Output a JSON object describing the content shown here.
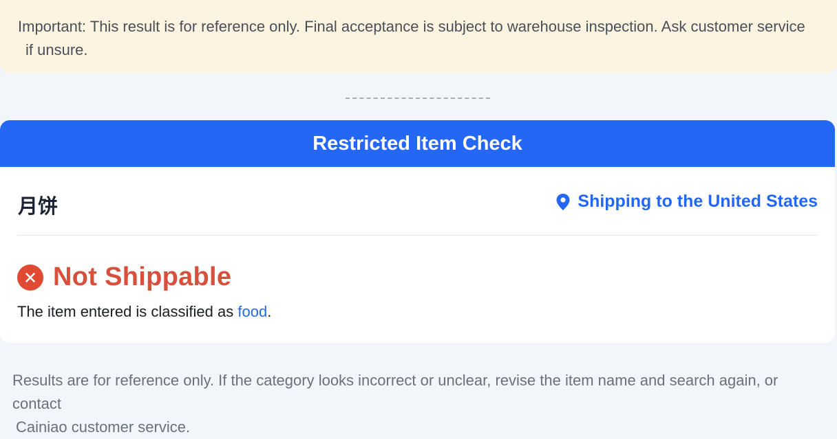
{
  "notice": {
    "line1": "Important: This result is for reference only. Final acceptance is subject to warehouse inspection. Ask customer service",
    "line2": "if unsure."
  },
  "card": {
    "title": "Restricted Item Check",
    "item_name": "月饼",
    "destination": "Shipping to the United States",
    "status": "Not Shippable",
    "classification_prefix": "The item entered is classified as ",
    "category": "food",
    "classification_suffix": "."
  },
  "footer": {
    "line1": "Results are for reference only. If the category looks incorrect or unclear, revise the item name and search again, or contact",
    "line2": "Cainiao customer service."
  },
  "colors": {
    "accent": "#2567f5",
    "error": "#e04a33",
    "notice_bg": "#fdf3e1"
  },
  "icons": {
    "destination": "location-pin-icon",
    "status": "close-circle-icon"
  }
}
